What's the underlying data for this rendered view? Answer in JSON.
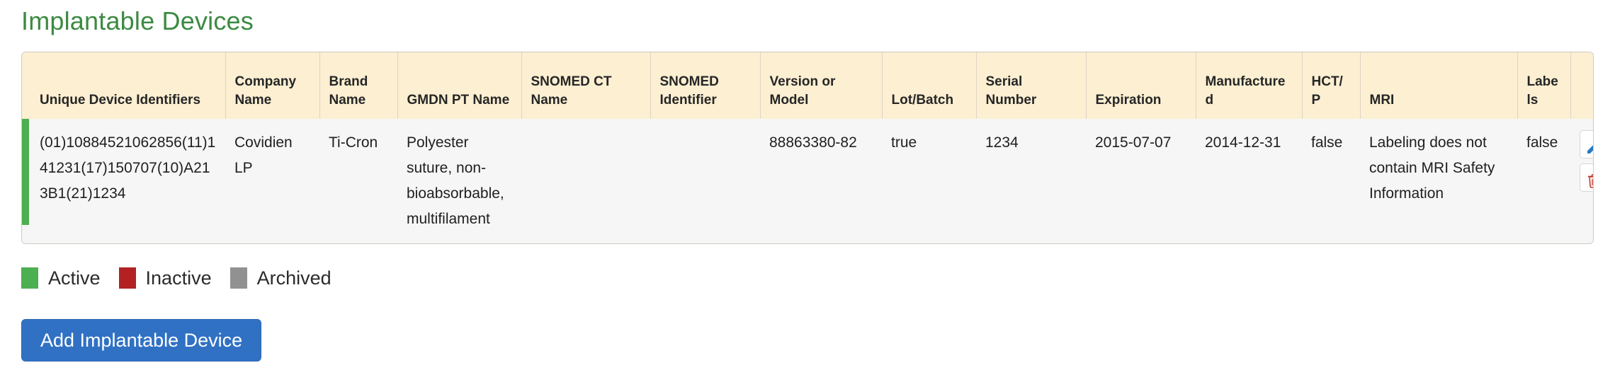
{
  "page": {
    "title": "Implantable Devices",
    "title_color": "#3c8a42"
  },
  "table": {
    "columns": [
      "Unique Device Identifiers",
      "Company Name",
      "Brand Name",
      "GMDN PT Name",
      "SNOMED CT Name",
      "SNOMED Identifier",
      "Version or Model",
      "Lot/Batch",
      "Serial Number",
      "Expiration",
      "Manufactured",
      "HCT/P",
      "MRI",
      "Labels"
    ],
    "rows": [
      {
        "status": "Active",
        "status_color": "#4caf50",
        "unique_device_identifiers": "(01)10884521062856(11)141231(17)150707(10)A213B1(21)1234",
        "company_name": "Covidien LP",
        "brand_name": "Ti-Cron",
        "gmdn_pt_name": "Polyester suture, non-bioabsorbable, multifilament",
        "snomed_ct_name": "",
        "snomed_identifier": "",
        "version_or_model": "88863380-82",
        "lot_batch": "true",
        "serial_number": "1234",
        "expiration": "2015-07-07",
        "manufactured": "2014-12-31",
        "hct_p": "false",
        "mri": "Labeling does not contain MRI Safety Information",
        "labels": "false",
        "actions": {
          "edit": "edit-pencil-icon",
          "delete": "trash-icon"
        }
      }
    ]
  },
  "legend": {
    "items": [
      {
        "label": "Active",
        "color": "#4caf50"
      },
      {
        "label": "Inactive",
        "color": "#b22222"
      },
      {
        "label": "Archived",
        "color": "#919191"
      }
    ]
  },
  "footer": {
    "add_button_label": "Add Implantable Device",
    "add_button_color": "#3071c4"
  }
}
